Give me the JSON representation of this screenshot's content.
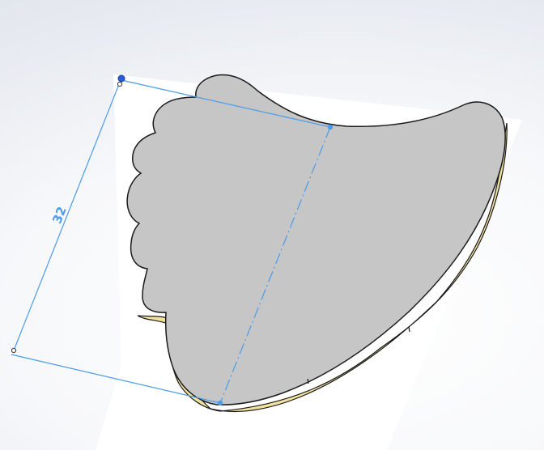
{
  "viewport": {
    "background_top": "#dde1e9",
    "background_center": "#ffffff"
  },
  "part": {
    "fill_color": "#c6c6c6",
    "edge_color": "#1a1a1a",
    "side_color": "#f2e2a0"
  },
  "sketch_plane": {
    "color": "#ffffff"
  },
  "dimension": {
    "value": "32",
    "color": "#4a9bea"
  },
  "centerline": {
    "color": "#4a9bea"
  }
}
